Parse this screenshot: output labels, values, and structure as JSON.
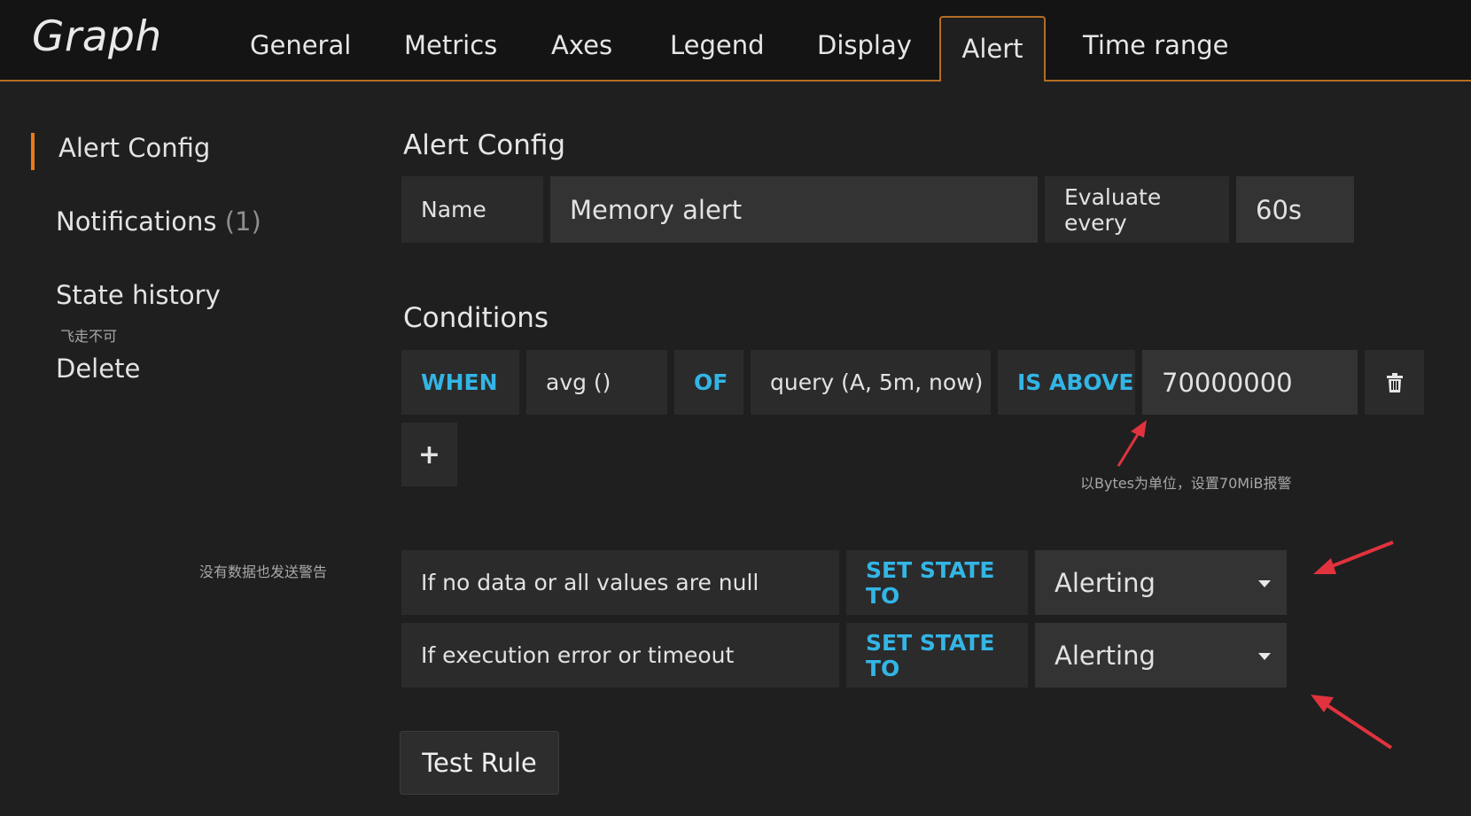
{
  "header": {
    "title": "Graph",
    "tabs": [
      {
        "label": "General"
      },
      {
        "label": "Metrics"
      },
      {
        "label": "Axes"
      },
      {
        "label": "Legend"
      },
      {
        "label": "Display"
      },
      {
        "label": "Alert",
        "active": true
      },
      {
        "label": "Time range"
      }
    ]
  },
  "sidebar": {
    "items": [
      {
        "label": "Alert Config",
        "active": true
      },
      {
        "label": "Notifications",
        "count": "(1)"
      },
      {
        "label": "State history"
      },
      {
        "label": "Delete"
      }
    ],
    "notes": {
      "state_history": "飞走不可",
      "no_data": "没有数据也发送警告"
    }
  },
  "alert_config": {
    "title": "Alert Config",
    "name_label": "Name",
    "name_value": "Memory alert",
    "evaluate_label": "Evaluate every",
    "evaluate_value": "60s"
  },
  "conditions": {
    "title": "Conditions",
    "when_label": "WHEN",
    "reducer": "avg ()",
    "of_label": "OF",
    "query": "query (A, 5m, now)",
    "evaluator": "IS ABOVE",
    "threshold": "70000000",
    "add_label": "+",
    "threshold_note": "以Bytes为单位，设置70MiB报警"
  },
  "states": {
    "no_data_label": "If no data or all values are null",
    "no_data_set": "SET STATE TO",
    "no_data_value": "Alerting",
    "exec_error_label": "If execution error or timeout",
    "exec_error_set": "SET STATE TO",
    "exec_error_value": "Alerting"
  },
  "actions": {
    "test_rule": "Test Rule"
  },
  "colors": {
    "accent_orange": "#eb7b18",
    "keyword_blue": "#33b5e5",
    "annotation_red": "#e0333d"
  },
  "icons": {
    "delete_condition": "trash-icon",
    "select_caret": "caret-down-icon"
  }
}
